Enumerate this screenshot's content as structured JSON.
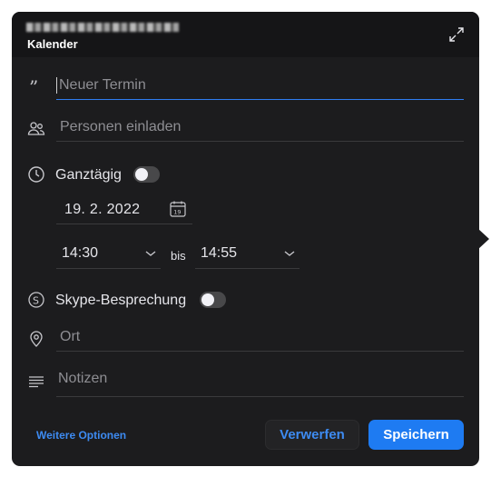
{
  "header": {
    "title": "Kalender",
    "expand_icon": "expand-icon"
  },
  "title_field": {
    "placeholder": "Neuer Termin",
    "icon": "quote-icon"
  },
  "invite_field": {
    "placeholder": "Personen einladen",
    "icon": "people-icon"
  },
  "all_day": {
    "label": "Ganztägig",
    "on": false,
    "icon": "clock-icon"
  },
  "date": {
    "value": "19.  2. 2022",
    "icon": "calendar-icon"
  },
  "time": {
    "start": "14:30",
    "separator": "bis",
    "end": "14:55"
  },
  "skype": {
    "label": "Skype-Besprechung",
    "on": false,
    "icon": "skype-icon"
  },
  "location_field": {
    "placeholder": "Ort",
    "icon": "location-pin-icon"
  },
  "notes_field": {
    "placeholder": "Notizen",
    "icon": "notes-icon"
  },
  "footer": {
    "more_options": "Weitere Optionen",
    "discard": "Verwerfen",
    "save": "Speichern"
  },
  "colors": {
    "panel": "#1c1c1e",
    "accent": "#1e7bf2",
    "link": "#3d8bf2"
  }
}
